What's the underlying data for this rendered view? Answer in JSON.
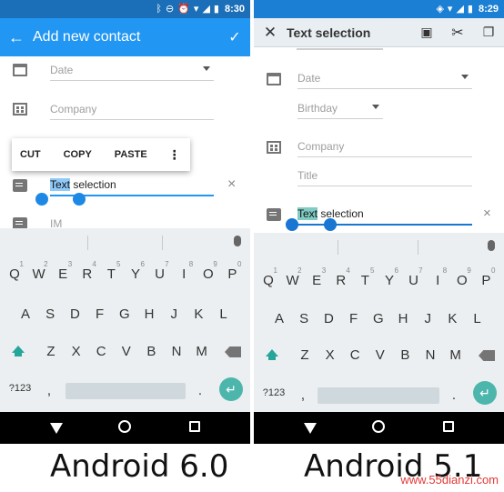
{
  "android60": {
    "status_time": "8:30",
    "appbar": {
      "nav_icon": "back-arrow-icon",
      "title": "Add new contact",
      "action_icon": "check-icon"
    },
    "fields": {
      "date": "Date",
      "company": "Company",
      "text_before": "",
      "text_selected": "Text",
      "text_after": " selection",
      "im": "IM"
    },
    "toolbar": {
      "cut": "CUT",
      "copy": "COPY",
      "paste": "PASTE",
      "more": "⋮"
    },
    "clear_icon": "×",
    "keyboard": {
      "row1": [
        "Q",
        "W",
        "E",
        "R",
        "T",
        "Y",
        "U",
        "I",
        "O",
        "P"
      ],
      "row1_hints": [
        "1",
        "2",
        "3",
        "4",
        "5",
        "6",
        "7",
        "8",
        "9",
        "0"
      ],
      "row2": [
        "A",
        "S",
        "D",
        "F",
        "G",
        "H",
        "J",
        "K",
        "L"
      ],
      "row3": [
        "Z",
        "X",
        "C",
        "V",
        "B",
        "N",
        "M"
      ],
      "sym": "?123",
      "comma": ",",
      "period": "."
    },
    "caption": "Android 6.0"
  },
  "android51": {
    "status_time": "8:29",
    "appbar": {
      "nav_icon": "close-icon",
      "title": "Text selection",
      "select_all_icon": "select-all-icon",
      "cut_icon": "scissors-icon",
      "copy_icon": "copy-icon"
    },
    "fields": {
      "date": "Date",
      "birthday": "Birthday",
      "company": "Company",
      "title": "Title",
      "text_selected": "Text",
      "text_after": " selection"
    },
    "clear_icon": "×",
    "keyboard": {
      "row1": [
        "Q",
        "W",
        "E",
        "R",
        "T",
        "Y",
        "U",
        "I",
        "O",
        "P"
      ],
      "row1_hints": [
        "1",
        "2",
        "3",
        "4",
        "5",
        "6",
        "7",
        "8",
        "9",
        "0"
      ],
      "row2": [
        "A",
        "S",
        "D",
        "F",
        "G",
        "H",
        "J",
        "K",
        "L"
      ],
      "row3": [
        "Z",
        "X",
        "C",
        "V",
        "B",
        "N",
        "M"
      ],
      "sym": "?123",
      "comma": ",",
      "period": "."
    },
    "caption": "Android 5.1"
  },
  "watermark": "www.55dianzi.com",
  "colors": {
    "accent60": "#2196f3",
    "statusbar60": "#1b6fb8",
    "accent51": "#1b7fd4",
    "teal": "#4db6ac"
  }
}
